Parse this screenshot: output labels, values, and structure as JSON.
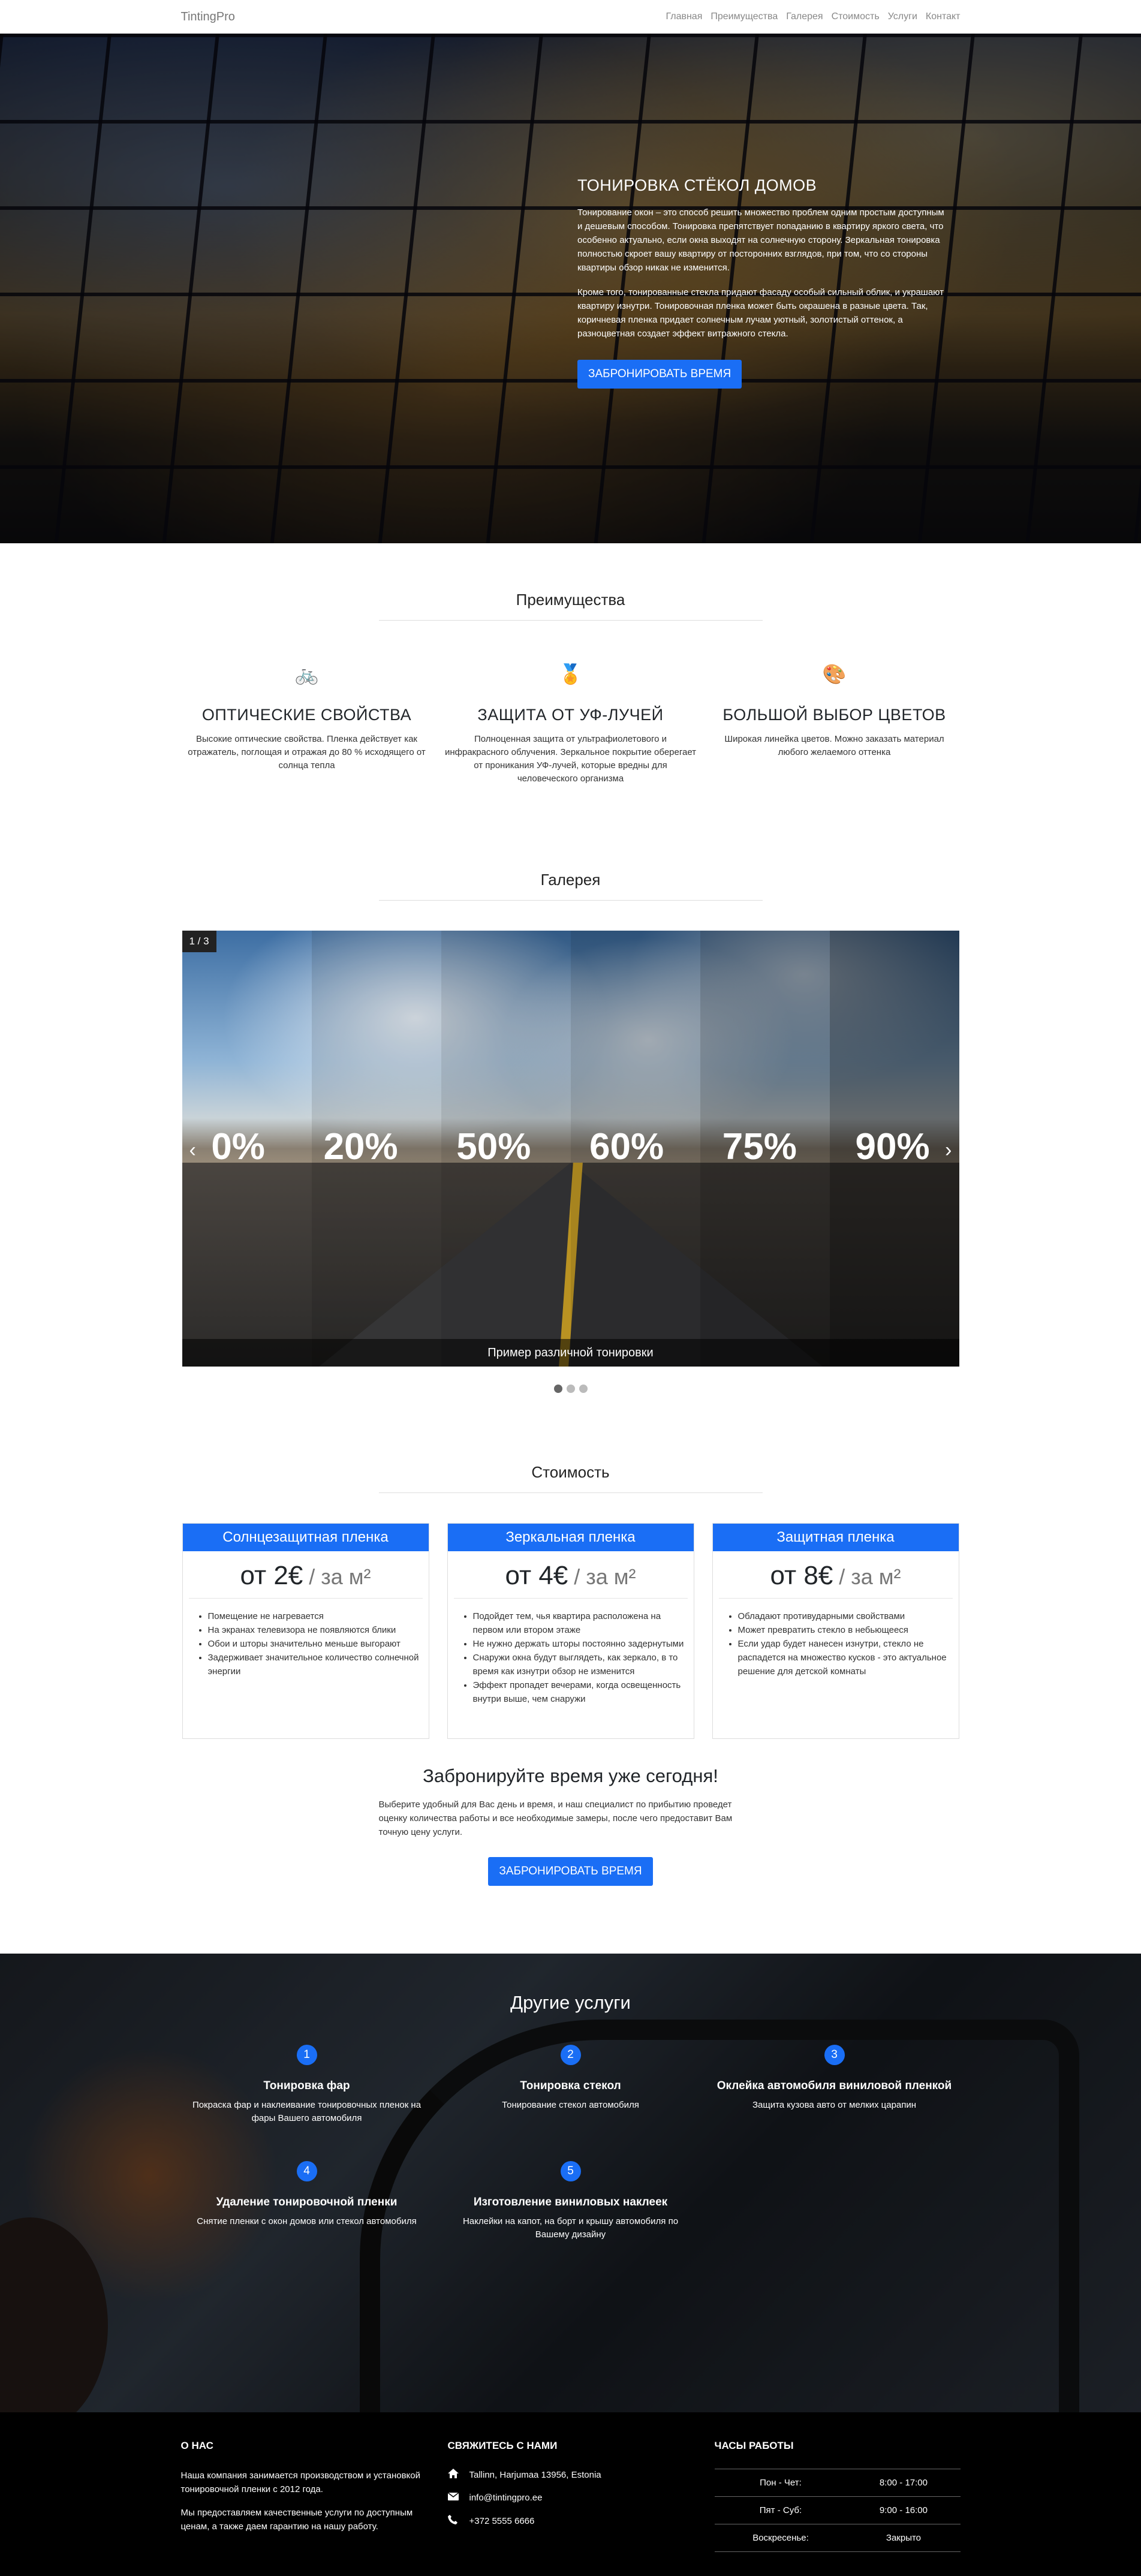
{
  "nav": {
    "brand": "TintingPro",
    "items": [
      "Главная",
      "Преимущества",
      "Галерея",
      "Стоимость",
      "Услуги",
      "Контакт"
    ]
  },
  "hero": {
    "title": "ТОНИРОВКА СТЁКОЛ ДОМОВ",
    "p1": "Тонирование окон – это способ решить множество проблем одним простым доступным и дешевым способом. Тонировка препятствует попаданию в квартиру яркого света, что особенно актуально, если окна выходят на солнечную сторону. Зеркальная тонировка полностью скроет вашу квартиру от посторонних взглядов, при том, что со стороны квартиры обзор никак не изменится.",
    "p2": "Кроме того, тонированные стекла придают фасаду особый сильный облик, и украшают квартиру изнутри. Тонировочная пленка может быть окрашена в разные цвета. Так, коричневая пленка придает солнечным лучам уютный, золотистый оттенок, а разноцветная создает эффект витражного стекла.",
    "button": "ЗАБРОНИРОВАТЬ ВРЕМЯ"
  },
  "features": {
    "title": "Преимущества",
    "items": [
      {
        "icon": "🚲",
        "title": "ОПТИЧЕСКИЕ СВОЙСТВА",
        "text": "Высокие оптические свойства. Пленка действует как отражатель, поглощая и отражая до 80 % исходящего от солнца тепла"
      },
      {
        "icon": "🏅",
        "title": "ЗАЩИТА ОТ УФ-ЛУЧЕЙ",
        "text": "Полноценная защита от ультрафиолетового и инфракрасного облучения. Зеркальное покрытие оберегает от проникания УФ-лучей, которые вредны для человеческого организма"
      },
      {
        "icon": "🎨",
        "title": "БОЛЬШОЙ ВЫБОР ЦВЕТОВ",
        "text": "Широкая линейка цветов. Можно заказать материал любого желаемого оттенка"
      }
    ]
  },
  "gallery": {
    "title": "Галерея",
    "counter": "1 / 3",
    "percentages": [
      "0%",
      "20%",
      "50%",
      "60%",
      "75%",
      "90%"
    ],
    "caption": "Пример различной тонировки",
    "prev": "‹",
    "next": "›"
  },
  "pricing": {
    "title": "Стоимость",
    "plans": [
      {
        "name": "Солнцезащитная пленка",
        "price": "от 2€",
        "per": " / за м²",
        "features": [
          "Помещение не нагревается",
          "На экранах телевизора не появляются блики",
          "Обои и шторы значительно меньше выгорают",
          "Задерживает значительное количество солнечной энергии"
        ]
      },
      {
        "name": "Зеркальная пленка",
        "price": "от 4€",
        "per": " / за м²",
        "features": [
          "Подойдет тем, чья квартира расположена на первом или втором этаже",
          "Не нужно держать шторы постоянно задернутыми",
          "Снаружи окна будут выглядеть, как зеркало, в то время как изнутри обзор не изменится",
          "Эффект пропадет вечерами, когда освещенность внутри выше, чем снаружи"
        ]
      },
      {
        "name": "Защитная пленка",
        "price": "от 8€",
        "per": " / за м²",
        "features": [
          "Обладают противударными свойствами",
          "Может превратить стекло в небьющееся",
          "Если удар будет нанесен изнутри, стекло не распадется на множество кусков - это актуальное решение для детской комнаты"
        ]
      }
    ],
    "book_title": "Забронируйте время уже сегодня!",
    "book_text": "Выберите удобный для Вас день и время, и наш специалист по прибытию проведет оценку количества работы и все необходимые замеры, после чего предоставит Вам точную цену услуги.",
    "button": "ЗАБРОНИРОВАТЬ ВРЕМЯ"
  },
  "services": {
    "title": "Другие услуги",
    "items": [
      {
        "num": "1",
        "title": "Тонировка фар",
        "text": "Покраска фар и наклеивание тонировочных пленок на фары Вашего автомобиля"
      },
      {
        "num": "2",
        "title": "Тонировка стекол",
        "text": "Тонирование стекол автомобиля"
      },
      {
        "num": "3",
        "title": "Оклейка автомобиля виниловой пленкой",
        "text": "Защита кузова авто от мелких царапин"
      },
      {
        "num": "4",
        "title": "Удаление тонировочной пленки",
        "text": "Снятие пленки с окон домов или стекол автомобиля"
      },
      {
        "num": "5",
        "title": "Изготовление виниловых наклеек",
        "text": "Наклейки на капот, на борт и крышу автомобиля по Вашему дизайну"
      }
    ]
  },
  "footer": {
    "about_title": "О НАС",
    "about_p1": "Наша компания занимается производством и установкой тонировочной пленки с 2012 года.",
    "about_p2": "Мы предоставляем качественные услуги по доступным ценам, а также даем гарантию на нашу работу.",
    "contact_title": "СВЯЖИТЕСЬ С НАМИ",
    "address": "Tallinn, Harjumaa 13956, Estonia",
    "email": "info@tintingpro.ee",
    "phone": "+372 5555 6666",
    "hours_title": "ЧАСЫ РАБОТЫ",
    "hours": [
      {
        "day": "Пон - Чет:",
        "time": "8:00 - 17:00"
      },
      {
        "day": "Пят - Суб:",
        "time": "9:00 - 16:00"
      },
      {
        "day": "Воскресенье:",
        "time": "Закрыто"
      }
    ]
  }
}
